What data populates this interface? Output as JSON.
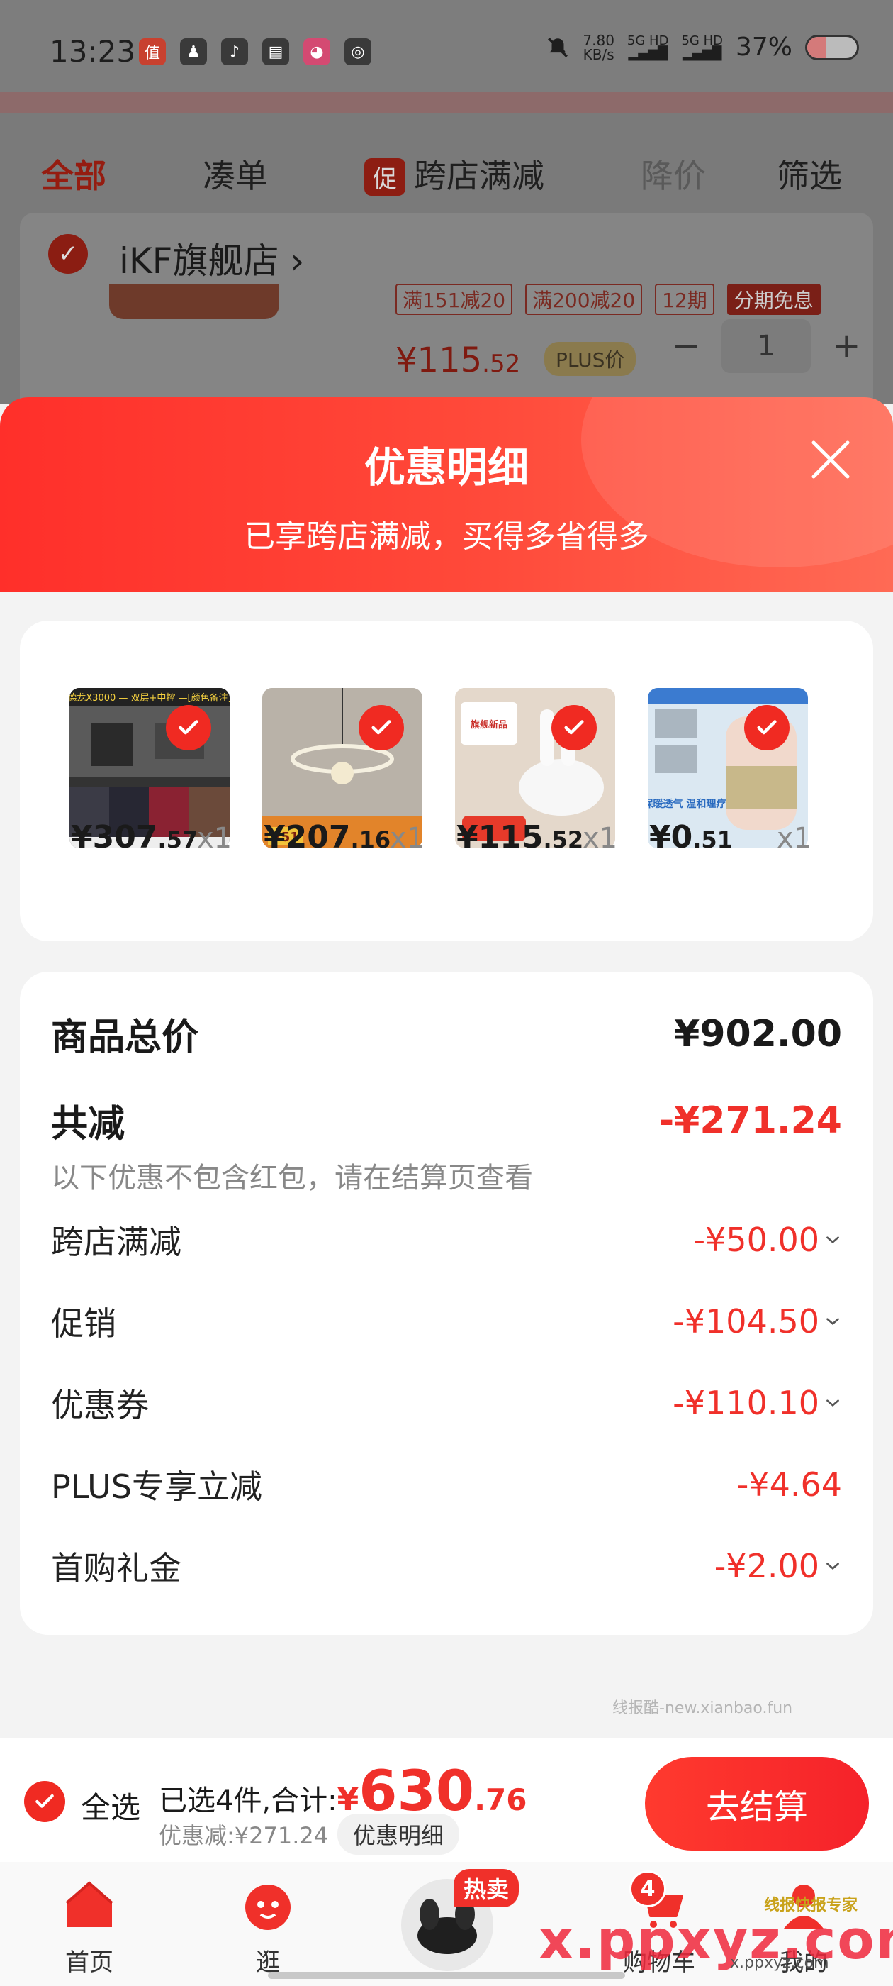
{
  "status_bar": {
    "time": "13:23",
    "net_speed_top": "7.80",
    "net_speed_bottom": "KB/s",
    "sig1": "5G HD",
    "sig2": "5G HD",
    "battery": "37%",
    "battery_level": 0.37
  },
  "filter_tabs": {
    "all": "全部",
    "combine": "凑单",
    "promo_badge": "促",
    "cross_store": "跨店满减",
    "price_drop": "降价",
    "filter": "筛选"
  },
  "bg_store": {
    "name": "iKF旗舰店",
    "tags": [
      "满151减20",
      "满200减20"
    ],
    "tag_fill_a": "12期",
    "tag_fill_b": "分期免息",
    "price_main": "¥115",
    "price_dec": ".52",
    "plus_label": "PLUS价",
    "qty": "1",
    "minus": "−",
    "plus": "+"
  },
  "sheet": {
    "title": "优惠明细",
    "subtitle": "已享跨店满减，买得多省得多"
  },
  "products": [
    {
      "yen": "¥",
      "int": "307",
      "dec": ".57",
      "qty": "x1",
      "img_text": "德龙X3000 — 双层+中控 —[颜色备注]"
    },
    {
      "yen": "¥",
      "int": "207",
      "dec": ".16",
      "qty": "x1",
      "img_text": "251"
    },
    {
      "yen": "¥",
      "int": "115",
      "dec": ".52",
      "qty": "x1",
      "img_text": "旗舰新品"
    },
    {
      "yen": "¥",
      "int": "0",
      "dec": ".51",
      "qty": "x1",
      "img_text": "保暖透气 温和理疗"
    }
  ],
  "totals": {
    "total_label": "商品总价",
    "total_value": "¥902.00",
    "discount_label": "共减",
    "discount_value": "-¥271.24",
    "note": "以下优惠不包含红包，请在结算页查看",
    "items": [
      {
        "label": "跨店满减",
        "value": "-¥50.00"
      },
      {
        "label": "促销",
        "value": "-¥104.50"
      },
      {
        "label": "优惠券",
        "value": "-¥110.10"
      },
      {
        "label": "PLUS专享立减",
        "value": "-¥4.64"
      },
      {
        "label": "首购礼金",
        "value": "-¥2.00"
      }
    ]
  },
  "watermark_small": "线报酷-new.xianbao.fun",
  "checkout": {
    "select_all": "全选",
    "summary_prefix": "已选4件,合计:",
    "total_yen": "¥",
    "total_int": "630",
    "total_dec": ".76",
    "discount_text": "优惠减:¥271.24",
    "detail_pill": "优惠明细",
    "button": "去结算"
  },
  "bottom_nav": {
    "home": "首页",
    "browse": "逛",
    "hot_badge": "热卖",
    "cart": "购物车",
    "cart_count": "4",
    "mine": "我的"
  },
  "watermark": {
    "big": "x.ppxyz.com",
    "sub": "x.ppxyz.com",
    "logo": "线报快报专家"
  },
  "colors": {
    "accent_red": "#f0302a",
    "header_gradient_start": "#ff2f2a",
    "header_gradient_end": "#ff6a55"
  }
}
